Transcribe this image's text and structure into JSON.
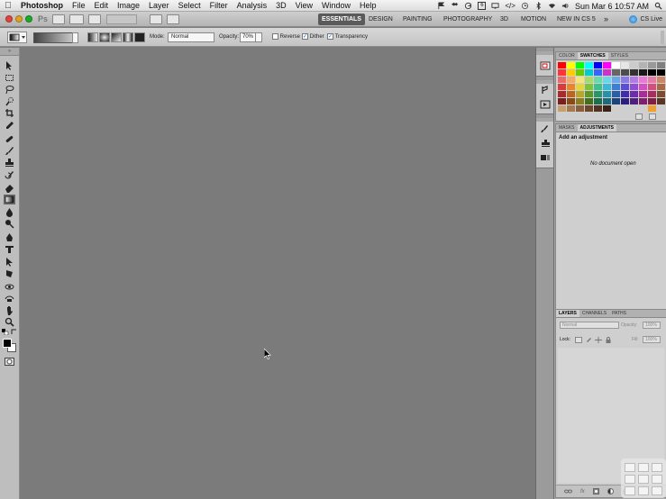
{
  "menubar": {
    "items": [
      "Photoshop",
      "File",
      "Edit",
      "Image",
      "Layer",
      "Select",
      "Filter",
      "Analysis",
      "3D",
      "View",
      "Window",
      "Help"
    ],
    "status_icons": [
      "flag-icon",
      "dropbox-icon",
      "sync-icon",
      "calendar-6-icon",
      "display-icon",
      "code-icon",
      "time-machine-icon",
      "bluetooth-icon",
      "wifi-icon",
      "volume-icon"
    ],
    "calendar_badge": "6",
    "clock": "Sun Mar 6  10:57 AM"
  },
  "appbar": {
    "logo": "Ps",
    "zoom_value": "",
    "workspaces": [
      "ESSENTIALS",
      "DESIGN",
      "PAINTING",
      "PHOTOGRAPHY",
      "3D",
      "MOTION",
      "NEW IN CS 5"
    ],
    "overflow": "»",
    "cs_live": "CS Live"
  },
  "options": {
    "mode_label": "Mode:",
    "mode_value": "Normal",
    "opacity_label": "Opacity:",
    "opacity_value": "70%",
    "reverse_label": "Reverse",
    "dither_label": "Dither",
    "transparency_label": "Transparency"
  },
  "panels": {
    "color_tabs": [
      "COLOR",
      "SWATCHES",
      "STYLES"
    ],
    "adj_tabs": [
      "MASKS",
      "ADJUSTMENTS"
    ],
    "adj_title": "Add an adjustment",
    "adj_empty": "No document open",
    "layer_tabs": [
      "LAYERS",
      "CHANNELS",
      "PATHS"
    ],
    "blend_mode": "Normal",
    "opacity_label": "Opacity:",
    "opacity_value": "100%",
    "lock_label": "Lock:",
    "fill_label": "Fill:",
    "fill_value": "100%"
  },
  "colors": {
    "swatches": [
      "#ff0000",
      "#ffff00",
      "#00ff00",
      "#00ffff",
      "#0000ff",
      "#ff00ff",
      "#ffffff",
      "#e6e6e6",
      "#cccccc",
      "#b3b3b3",
      "#999999",
      "#808080",
      "#ff3333",
      "#ffcc00",
      "#66cc00",
      "#00cccc",
      "#3366ff",
      "#cc33cc",
      "#666666",
      "#4d4d4d",
      "#333333",
      "#1a1a1a",
      "#000000",
      "#000000",
      "#e86a6a",
      "#f3a96c",
      "#f6e47a",
      "#a8d96a",
      "#6ad9a8",
      "#6ad6e6",
      "#6aa8e6",
      "#8a7ae6",
      "#b37ae6",
      "#e67ad6",
      "#e67aa8",
      "#cc8866",
      "#d93a3a",
      "#e8862a",
      "#e6d43a",
      "#7ec23a",
      "#3ac28a",
      "#3ab8d6",
      "#3a7ed6",
      "#5a4ed6",
      "#8e4ed6",
      "#d64ec0",
      "#d64e80",
      "#a86a44",
      "#a82a2a",
      "#b86620",
      "#b8a82a",
      "#5e962a",
      "#2a9668",
      "#2a90a8",
      "#2a5ea8",
      "#402ea8",
      "#6c2ea8",
      "#a82e96",
      "#a82e60",
      "#7a4c30",
      "#7a1e1e",
      "#8a4a16",
      "#8a7e1e",
      "#44701e",
      "#1e704c",
      "#1e6a7e",
      "#1e447e",
      "#2c207e",
      "#4e207e",
      "#7e206e",
      "#7e2044",
      "#5a3622",
      "#c8a070",
      "#a57a50",
      "#8a5e3a",
      "#6e4628",
      "#523220",
      "#3a2216",
      "#cfcfcf",
      "#cfcfcf",
      "#cfcfcf",
      "#cfcfcf",
      "#f0a030",
      "#cfcfcf"
    ]
  }
}
